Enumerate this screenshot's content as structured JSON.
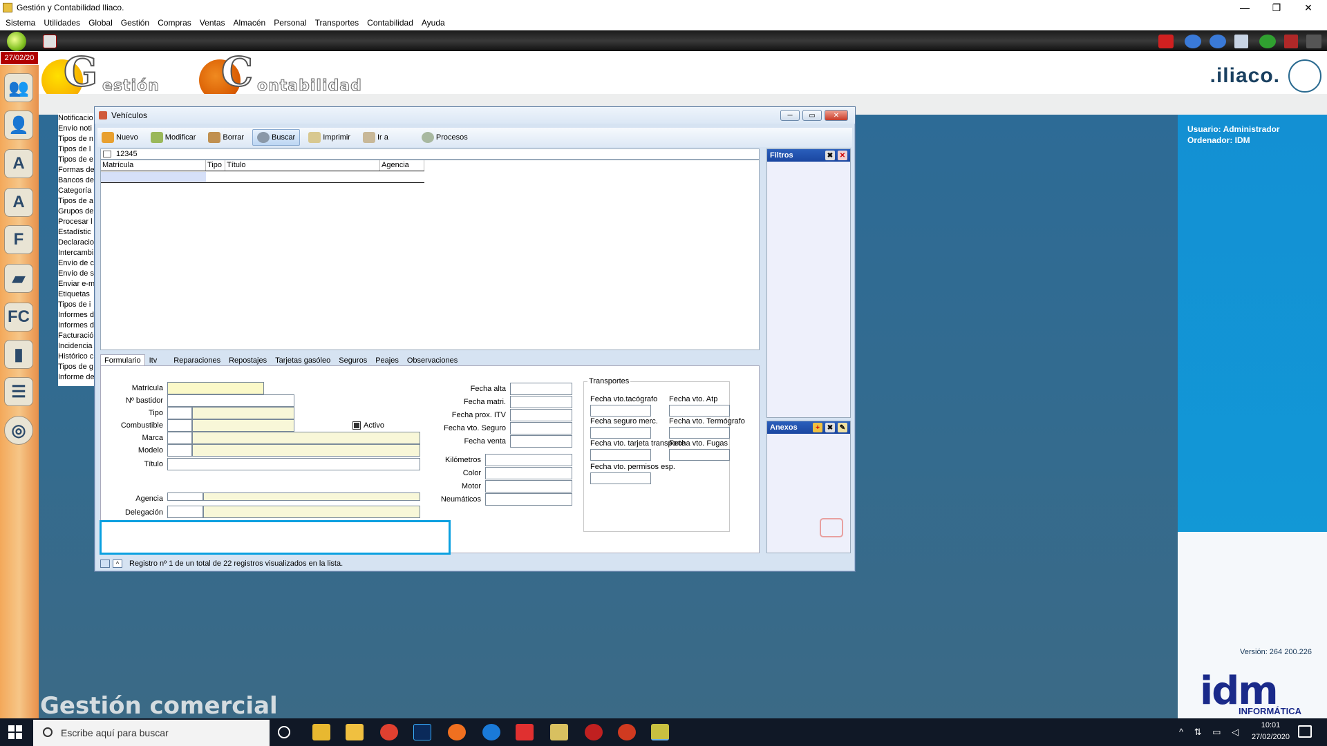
{
  "window_title": "Gestión y Contabilidad Iliaco.",
  "menu": [
    "Sistema",
    "Utilidades",
    "Global",
    "Gestión",
    "Compras",
    "Ventas",
    "Almacén",
    "Personal",
    "Transportes",
    "Contabilidad",
    "Ayuda"
  ],
  "date_badge": "27/02/20",
  "logo": {
    "g1": "G",
    "g1_text": "estión",
    "g2": "C",
    "g2_text": "ontabilidad",
    "brand": ".iliaco."
  },
  "bg_list": [
    "Notificacio",
    "Envío noti",
    "Tipos de n",
    "Tipos de l",
    "Tipos de e",
    "Formas de",
    "Bancos de",
    "Categoría",
    "Tipos de a",
    "Grupos de",
    "Procesar l",
    "Estadístic",
    "Declaracio",
    "Intercambi",
    "Envío de c",
    "Envío de s",
    "Enviar e-m",
    "Etiquetas",
    "Tipos de i",
    "Informes d",
    "Informes d",
    "Facturació",
    "Incidencia",
    "Histórico c",
    "Tipos de g",
    "Informe de"
  ],
  "user_info": {
    "usuario": "Usuario: Administrador",
    "ordenador": "Ordenador:  IDM"
  },
  "version": "Versión: 264 200.226",
  "idm": {
    "logo": "idm",
    "sub": "INFORMÁTICA"
  },
  "bottom_caption": "Gestión comercial",
  "vehicles_window": {
    "title": "Vehículos",
    "toolbar": [
      "Nuevo",
      "Modificar",
      "Borrar",
      "Buscar",
      "Imprimir",
      "Ir a",
      "Procesos"
    ],
    "search_value": "12345",
    "grid_columns": [
      "Matrícula",
      "Tipo",
      "Título",
      "Agencia"
    ],
    "filters_title": "Filtros",
    "anexos_title": "Anexos",
    "tabs": [
      "Formulario",
      "Itv",
      "Reparaciones",
      "Repostajes",
      "Tarjetas gasóleo",
      "Seguros",
      "Peajes",
      "Observaciones"
    ],
    "form_left": [
      "Matrícula",
      "Nº bastidor",
      "Tipo",
      "Combustible",
      "Marca",
      "Modelo",
      "Título",
      "Agencia",
      "Delegación"
    ],
    "activo_label": "Activo",
    "form_mid_dates": [
      "Fecha alta",
      "Fecha matri.",
      "Fecha prox. ITV",
      "Fecha vto. Seguro",
      "Fecha venta"
    ],
    "form_mid_other": [
      "Kilómetros",
      "Color",
      "Motor",
      "Neumáticos"
    ],
    "transportes_title": "Transportes",
    "transportes_fields": [
      "Fecha vto.tacógrafo",
      "Fecha vto. Atp",
      "Fecha seguro merc.",
      "Fecha vto. Termógrafo",
      "Fecha vto. tarjeta transporte",
      "Fecha vto. Fugas",
      "Fecha vto. permisos esp."
    ],
    "status": "Registro nº 1 de un total de 22 registros visualizados en la lista."
  },
  "taskbar": {
    "search_placeholder": "Escribe aquí para buscar",
    "time": "10:01",
    "date": "27/02/2020"
  }
}
